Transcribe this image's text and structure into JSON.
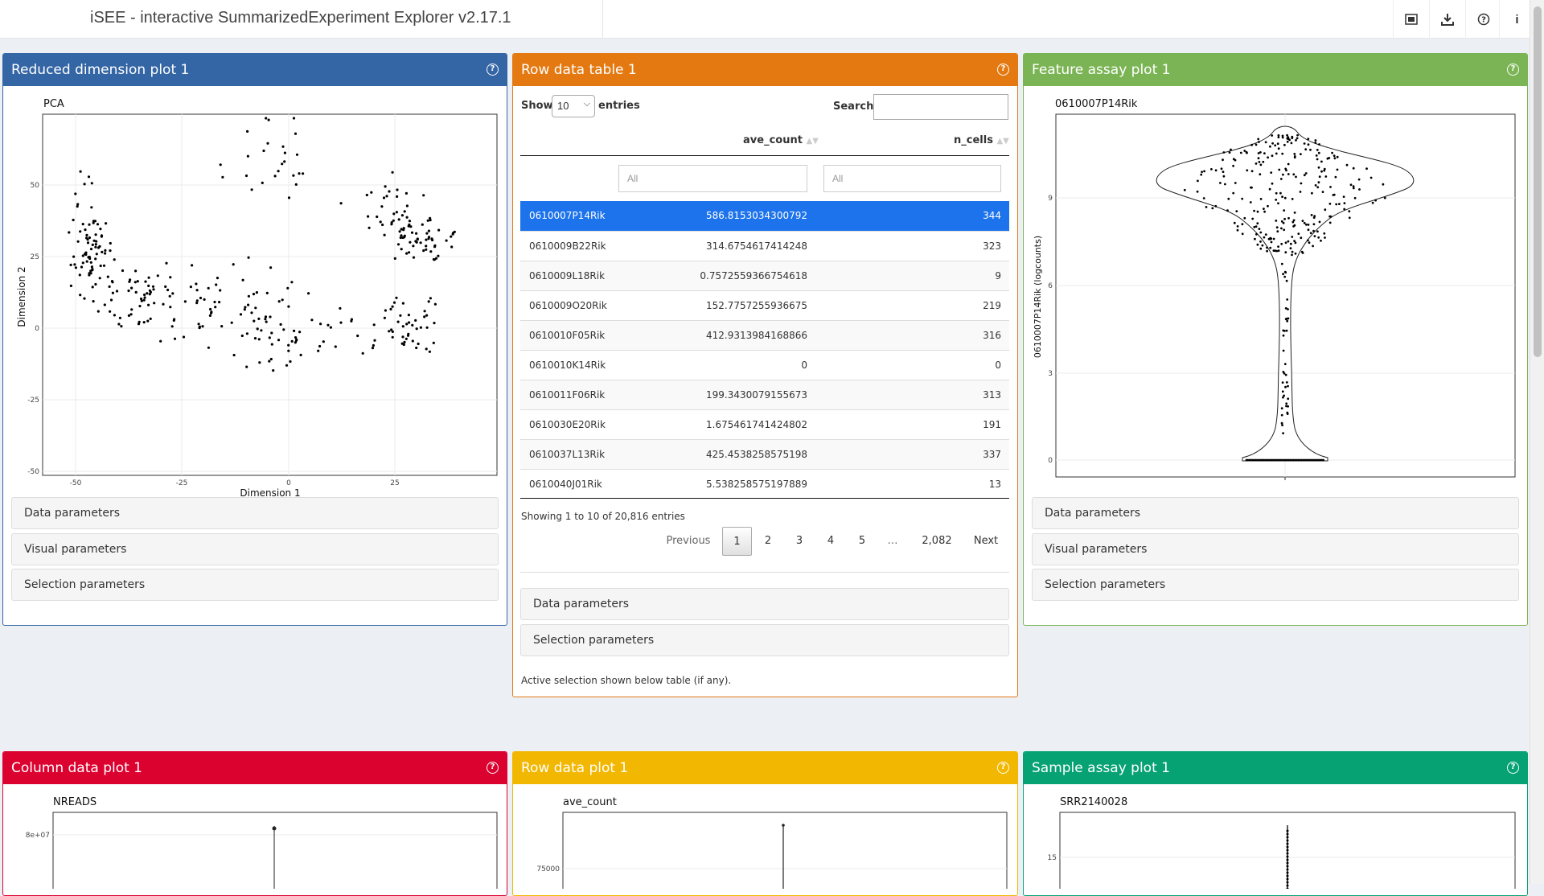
{
  "header": {
    "title": "iSEE - interactive SummarizedExperiment Explorer v2.17.1",
    "icons": [
      "screenshot-icon",
      "download-icon",
      "question-icon",
      "info-icon"
    ],
    "info_glyph": "i"
  },
  "colors": {
    "reduced_dim": "#3465a4",
    "row_table": "#e47911",
    "feature_assay": "#7bb454",
    "column_data": "#db0230",
    "row_data_plot": "#f2b701",
    "sample_assay": "#07a274",
    "selected_row": "#1d73eb"
  },
  "panels": {
    "reduced_dim": {
      "title": "Reduced dimension plot 1",
      "plot_title": "PCA",
      "xlabel": "Dimension 1",
      "ylabel": "Dimension 2",
      "xticks": [
        "-50",
        "-25",
        "0",
        "25"
      ],
      "yticks": [
        "50",
        "25",
        "0",
        "-25",
        "-50"
      ],
      "sections": [
        "Data parameters",
        "Visual parameters",
        "Selection parameters"
      ]
    },
    "row_table": {
      "title": "Row data table 1",
      "show_label": "Show",
      "page_size": "10",
      "entries_label": "entries",
      "search_label": "Search:",
      "columns": [
        "ave_count",
        "n_cells"
      ],
      "filter_placeholder": "All",
      "rows": [
        {
          "name": "0610007P14Rik",
          "ave_count": "586.8153034300792",
          "n_cells": "344"
        },
        {
          "name": "0610009B22Rik",
          "ave_count": "314.6754617414248",
          "n_cells": "323"
        },
        {
          "name": "0610009L18Rik",
          "ave_count": "0.7572559366754618",
          "n_cells": "9"
        },
        {
          "name": "0610009O20Rik",
          "ave_count": "152.7757255936675",
          "n_cells": "219"
        },
        {
          "name": "0610010F05Rik",
          "ave_count": "412.9313984168866",
          "n_cells": "316"
        },
        {
          "name": "0610010K14Rik",
          "ave_count": "0",
          "n_cells": "0"
        },
        {
          "name": "0610011F06Rik",
          "ave_count": "199.3430079155673",
          "n_cells": "313"
        },
        {
          "name": "0610030E20Rik",
          "ave_count": "1.675461741424802",
          "n_cells": "191"
        },
        {
          "name": "0610037L13Rik",
          "ave_count": "425.4538258575198",
          "n_cells": "337"
        },
        {
          "name": "0610040J01Rik",
          "ave_count": "5.538258575197889",
          "n_cells": "13"
        }
      ],
      "info": "Showing 1 to 10 of 20,816 entries",
      "pager": {
        "previous": "Previous",
        "pages": [
          "1",
          "2",
          "3",
          "4",
          "5",
          "…",
          "2,082"
        ],
        "next": "Next"
      },
      "sections": [
        "Data parameters",
        "Selection parameters"
      ],
      "footer": "Active selection shown below table (if any)."
    },
    "feature_assay": {
      "title": "Feature assay plot 1",
      "plot_title": "0610007P14Rik",
      "ylabel": "0610007P14Rik (logcounts)",
      "yticks": [
        "9",
        "6",
        "3",
        "0"
      ],
      "sections": [
        "Data parameters",
        "Visual parameters",
        "Selection parameters"
      ]
    },
    "column_data": {
      "title": "Column data plot 1",
      "plot_title": "NREADS",
      "ytick": "8e+07"
    },
    "row_data_plot": {
      "title": "Row data plot 1",
      "plot_title": "ave_count",
      "ytick": "75000"
    },
    "sample_assay": {
      "title": "Sample assay plot 1",
      "plot_title": "SRR2140028",
      "ytick": "15"
    }
  }
}
